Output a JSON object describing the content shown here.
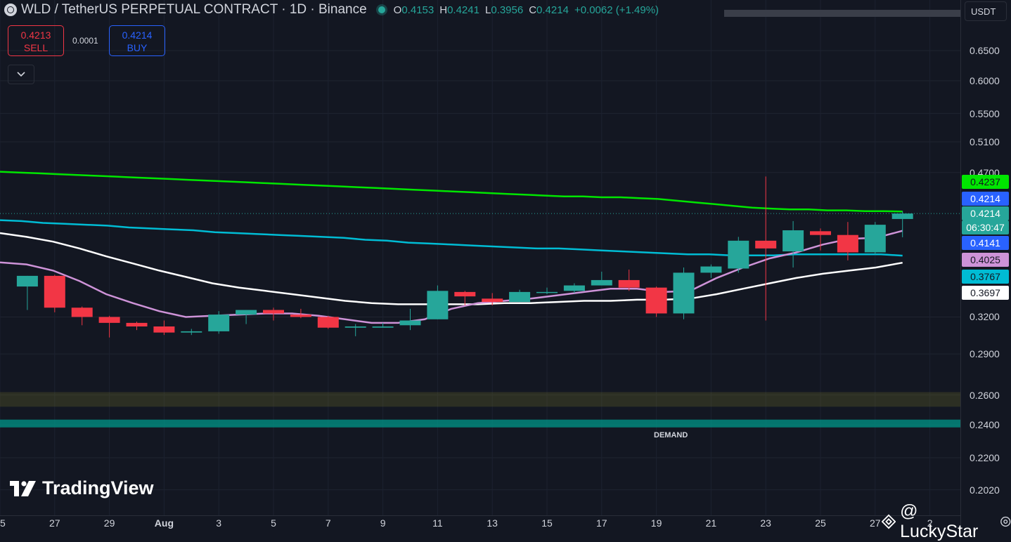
{
  "header": {
    "title": "WLD / TetherUS PERPETUAL CONTRACT · 1D · Binance",
    "ohlc": {
      "o_label": "O",
      "o": "0.4153",
      "h_label": "H",
      "h": "0.4241",
      "l_label": "L",
      "l": "0.3956",
      "c_label": "C",
      "c": "0.4214",
      "change": "+0.0062 (+1.49%)"
    }
  },
  "trade": {
    "sell_price": "0.4213",
    "sell_label": "SELL",
    "buy_price": "0.4214",
    "buy_label": "BUY",
    "spread": "0.0001"
  },
  "unit_selector": "USDT",
  "logo_text": "TradingView",
  "watermark": "@ LuckyStar",
  "colors": {
    "up": "#26a69a",
    "down": "#f23645",
    "bg": "#131722"
  },
  "chart_data": {
    "type": "candlestick",
    "scale": "log",
    "ylim": [
      0.195,
      0.72
    ],
    "xlim": [
      "Jul 25",
      "Aug 28"
    ],
    "y_ticks": [
      "0.6500",
      "0.6000",
      "0.5500",
      "0.5100",
      "0.4700",
      "0.4214",
      "0.3200",
      "0.2900",
      "0.2600",
      "0.2400",
      "0.2200",
      "0.2020"
    ],
    "x_ticks": [
      "25",
      "27",
      "29",
      "Aug",
      "3",
      "5",
      "7",
      "9",
      "11",
      "13",
      "15",
      "17",
      "19",
      "21",
      "23",
      "25",
      "27",
      "2"
    ],
    "candles": [
      {
        "date": "Jul 26",
        "o": 0.347,
        "h": 0.357,
        "l": 0.326,
        "c": 0.357
      },
      {
        "date": "Jul 27",
        "o": 0.357,
        "h": 0.358,
        "l": 0.324,
        "c": 0.328
      },
      {
        "date": "Jul 28",
        "o": 0.328,
        "h": 0.329,
        "l": 0.313,
        "c": 0.32
      },
      {
        "date": "Jul 29",
        "o": 0.32,
        "h": 0.321,
        "l": 0.303,
        "c": 0.315
      },
      {
        "date": "Jul 30",
        "o": 0.315,
        "h": 0.316,
        "l": 0.309,
        "c": 0.312
      },
      {
        "date": "Jul 31",
        "o": 0.312,
        "h": 0.317,
        "l": 0.305,
        "c": 0.307
      },
      {
        "date": "Aug 1",
        "o": 0.307,
        "h": 0.31,
        "l": 0.305,
        "c": 0.308
      },
      {
        "date": "Aug 2",
        "o": 0.308,
        "h": 0.325,
        "l": 0.306,
        "c": 0.322
      },
      {
        "date": "Aug 3",
        "o": 0.322,
        "h": 0.326,
        "l": 0.314,
        "c": 0.326
      },
      {
        "date": "Aug 4",
        "o": 0.326,
        "h": 0.328,
        "l": 0.317,
        "c": 0.323
      },
      {
        "date": "Aug 5",
        "o": 0.322,
        "h": 0.327,
        "l": 0.319,
        "c": 0.32
      },
      {
        "date": "Aug 6",
        "o": 0.32,
        "h": 0.321,
        "l": 0.31,
        "c": 0.311
      },
      {
        "date": "Aug 7",
        "o": 0.311,
        "h": 0.314,
        "l": 0.304,
        "c": 0.312
      },
      {
        "date": "Aug 8",
        "o": 0.311,
        "h": 0.315,
        "l": 0.311,
        "c": 0.312
      },
      {
        "date": "Aug 9",
        "o": 0.313,
        "h": 0.327,
        "l": 0.309,
        "c": 0.317
      },
      {
        "date": "Aug 10",
        "o": 0.318,
        "h": 0.348,
        "l": 0.318,
        "c": 0.343
      },
      {
        "date": "Aug 11",
        "o": 0.342,
        "h": 0.343,
        "l": 0.33,
        "c": 0.338
      },
      {
        "date": "Aug 12",
        "o": 0.336,
        "h": 0.341,
        "l": 0.33,
        "c": 0.333
      },
      {
        "date": "Aug 13",
        "o": 0.333,
        "h": 0.344,
        "l": 0.333,
        "c": 0.342
      },
      {
        "date": "Aug 14",
        "o": 0.342,
        "h": 0.346,
        "l": 0.34,
        "c": 0.342
      },
      {
        "date": "Aug 15",
        "o": 0.343,
        "h": 0.35,
        "l": 0.341,
        "c": 0.348
      },
      {
        "date": "Aug 16",
        "o": 0.348,
        "h": 0.361,
        "l": 0.348,
        "c": 0.353
      },
      {
        "date": "Aug 17",
        "o": 0.353,
        "h": 0.363,
        "l": 0.343,
        "c": 0.346
      },
      {
        "date": "Aug 18",
        "o": 0.346,
        "h": 0.347,
        "l": 0.32,
        "c": 0.323
      },
      {
        "date": "Aug 19",
        "o": 0.323,
        "h": 0.365,
        "l": 0.318,
        "c": 0.36
      },
      {
        "date": "Aug 20",
        "o": 0.36,
        "h": 0.368,
        "l": 0.355,
        "c": 0.366
      },
      {
        "date": "Aug 21",
        "o": 0.364,
        "h": 0.396,
        "l": 0.36,
        "c": 0.392
      },
      {
        "date": "Aug 22",
        "o": 0.392,
        "h": 0.465,
        "l": 0.317,
        "c": 0.384
      },
      {
        "date": "Aug 23",
        "o": 0.381,
        "h": 0.413,
        "l": 0.365,
        "c": 0.403
      },
      {
        "date": "Aug 24",
        "o": 0.402,
        "h": 0.405,
        "l": 0.382,
        "c": 0.398
      },
      {
        "date": "Aug 25",
        "o": 0.398,
        "h": 0.412,
        "l": 0.372,
        "c": 0.38
      },
      {
        "date": "Aug 26",
        "o": 0.38,
        "h": 0.412,
        "l": 0.378,
        "c": 0.409
      },
      {
        "date": "Aug 27",
        "o": 0.4153,
        "h": 0.4241,
        "l": 0.3956,
        "c": 0.4214
      }
    ],
    "indicators": [
      {
        "color": "#00e600",
        "last": "0.4237",
        "values": [
          0.471,
          0.47,
          0.469,
          0.468,
          0.467,
          0.466,
          0.465,
          0.464,
          0.463,
          0.462,
          0.461,
          0.46,
          0.459,
          0.458,
          0.457,
          0.456,
          0.455,
          0.454,
          0.453,
          0.452,
          0.451,
          0.45,
          0.449,
          0.448,
          0.447,
          0.446,
          0.445,
          0.444,
          0.443,
          0.442,
          0.441,
          0.441,
          0.44,
          0.44,
          0.439,
          0.438,
          0.436,
          0.434,
          0.432,
          0.43,
          0.428,
          0.427,
          0.426,
          0.426,
          0.425,
          0.425,
          0.424,
          0.424,
          0.4237
        ]
      },
      {
        "color": "#00bcd4",
        "last": "0.3767",
        "values": [
          0.414,
          0.413,
          0.411,
          0.41,
          0.409,
          0.408,
          0.406,
          0.405,
          0.404,
          0.403,
          0.401,
          0.4,
          0.399,
          0.398,
          0.397,
          0.396,
          0.395,
          0.393,
          0.392,
          0.39,
          0.389,
          0.388,
          0.387,
          0.386,
          0.385,
          0.384,
          0.384,
          0.383,
          0.382,
          0.381,
          0.38,
          0.379,
          0.378,
          0.378,
          0.377,
          0.377,
          0.377,
          0.378,
          0.378,
          0.378,
          0.378,
          0.378,
          0.3767
        ]
      },
      {
        "color": "#ffffff",
        "last": "0.3697",
        "values": [
          0.4,
          0.396,
          0.391,
          0.384,
          0.376,
          0.369,
          0.362,
          0.356,
          0.35,
          0.346,
          0.343,
          0.34,
          0.337,
          0.334,
          0.332,
          0.331,
          0.331,
          0.331,
          0.331,
          0.332,
          0.332,
          0.333,
          0.334,
          0.334,
          0.335,
          0.335,
          0.336,
          0.34,
          0.345,
          0.35,
          0.355,
          0.359,
          0.362,
          0.365,
          0.3697
        ]
      },
      {
        "color": "#ce93d8",
        "last": "0.4025",
        "values": [
          0.37,
          0.368,
          0.362,
          0.352,
          0.34,
          0.332,
          0.325,
          0.32,
          0.321,
          0.322,
          0.323,
          0.323,
          0.321,
          0.318,
          0.315,
          0.315,
          0.318,
          0.327,
          0.332,
          0.334,
          0.336,
          0.339,
          0.342,
          0.345,
          0.345,
          0.342,
          0.343,
          0.355,
          0.365,
          0.374,
          0.38,
          0.388,
          0.394,
          0.395,
          0.4025
        ]
      }
    ],
    "price_labels": [
      {
        "value": "0.4237",
        "bg": "#00e600",
        "fg": "#131722"
      },
      {
        "value": "0.4214",
        "bg": "#2962ff",
        "fg": "#ffffff"
      },
      {
        "value": "0.4214",
        "bg": "#26a69a",
        "fg": "#ffffff",
        "countdown": "06:30:47"
      },
      {
        "value": "0.4141",
        "bg": "#2962ff",
        "fg": "#ffffff"
      },
      {
        "value": "0.4025",
        "bg": "#ce93d8",
        "fg": "#131722"
      },
      {
        "value": "0.3767",
        "bg": "#00bcd4",
        "fg": "#131722"
      },
      {
        "value": "0.3697",
        "bg": "#ffffff",
        "fg": "#131722"
      }
    ],
    "zones": [
      {
        "label": "",
        "low": 0.252,
        "high": 0.262,
        "color": "rgba(120,120,40,0.25)"
      },
      {
        "label": "DEMAND",
        "low": 0.2385,
        "high": 0.2435,
        "color": "rgba(0,150,136,0.75)"
      }
    ]
  }
}
